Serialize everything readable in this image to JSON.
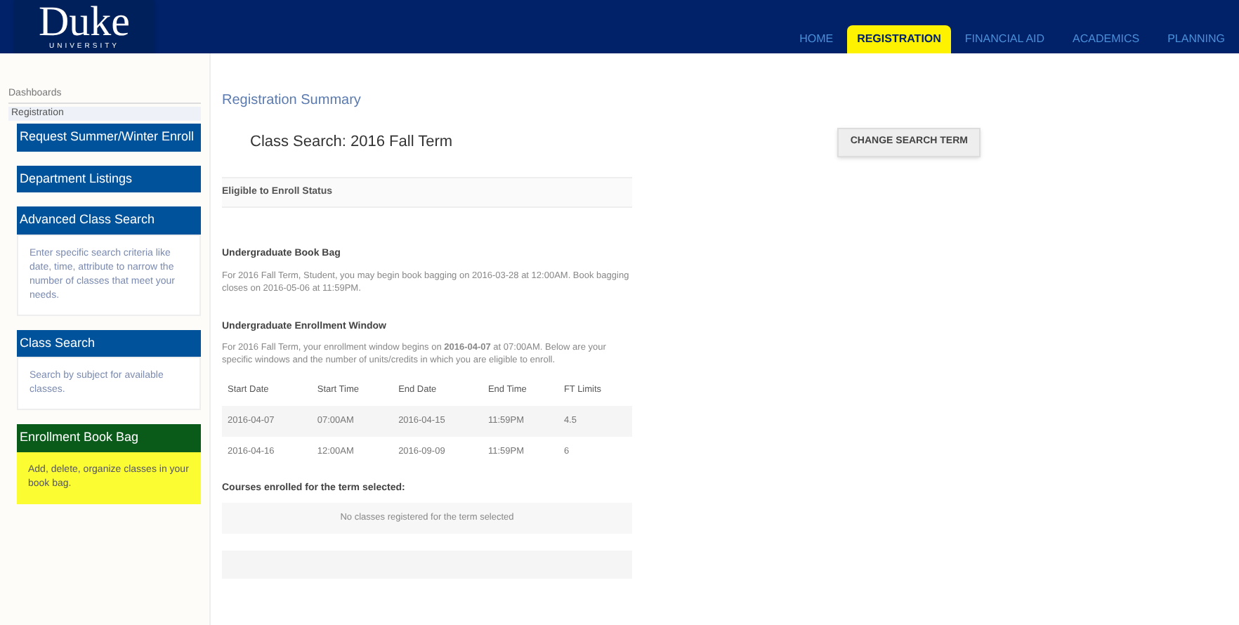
{
  "header": {
    "logo": "Duke",
    "logo_sub": "UNIVERSITY",
    "nav": [
      {
        "label": "HOME",
        "selected": false
      },
      {
        "label": "REGISTRATION",
        "selected": true
      },
      {
        "label": "FINANCIAL AID",
        "selected": false
      },
      {
        "label": "ACADEMICS",
        "selected": false
      },
      {
        "label": "PLANNING",
        "selected": false
      }
    ]
  },
  "sidebar": {
    "title": "Dashboards",
    "section": "Registration",
    "items": [
      {
        "label": "Request Summer/Winter Enroll",
        "kind": "plain"
      },
      {
        "label": "Department Listings",
        "kind": "plain"
      },
      {
        "label": "Advanced Class Search",
        "kind": "described",
        "description": "Enter specific search criteria like date, time, attribute to narrow the number of classes that meet your needs."
      },
      {
        "label": "Class Search",
        "kind": "described",
        "description": "Search by subject for available classes."
      },
      {
        "label": "Enrollment Book Bag",
        "kind": "highlight",
        "description": "Add, delete, organize classes in your book bag."
      }
    ]
  },
  "main": {
    "title": "Registration Summary",
    "term": "Class Search: 2016 Fall Term",
    "change_button": "CHANGE SEARCH TERM",
    "eligible_heading": "Eligible to Enroll Status",
    "book_bag": {
      "heading": "Undergraduate Book Bag",
      "text": "For 2016 Fall Term, Student, you may begin book bagging on 2016-03-28 at 12:00AM. Book bagging closes on 2016-05-06 at 11:59PM."
    },
    "window": {
      "heading": "Undergraduate Enrollment Window",
      "text": "For 2016 Fall Term, your enrollment window begins on **2016-04-07** at 07:00AM. Below are your specific windows and the number of units/credits in which you are eligible to enroll."
    },
    "table": {
      "columns": [
        "Start Date",
        "Start Time",
        "End Date",
        "End Time",
        "FT Limits"
      ],
      "rows": [
        [
          "2016-04-07",
          "07:00AM",
          "2016-04-15",
          "11:59PM",
          "4.5"
        ],
        [
          "2016-04-16",
          "12:00AM",
          "2016-09-09",
          "11:59PM",
          "6"
        ]
      ]
    },
    "courses_heading": "Courses enrolled for the term selected:",
    "courses_empty": "No classes registered for the term selected"
  }
}
